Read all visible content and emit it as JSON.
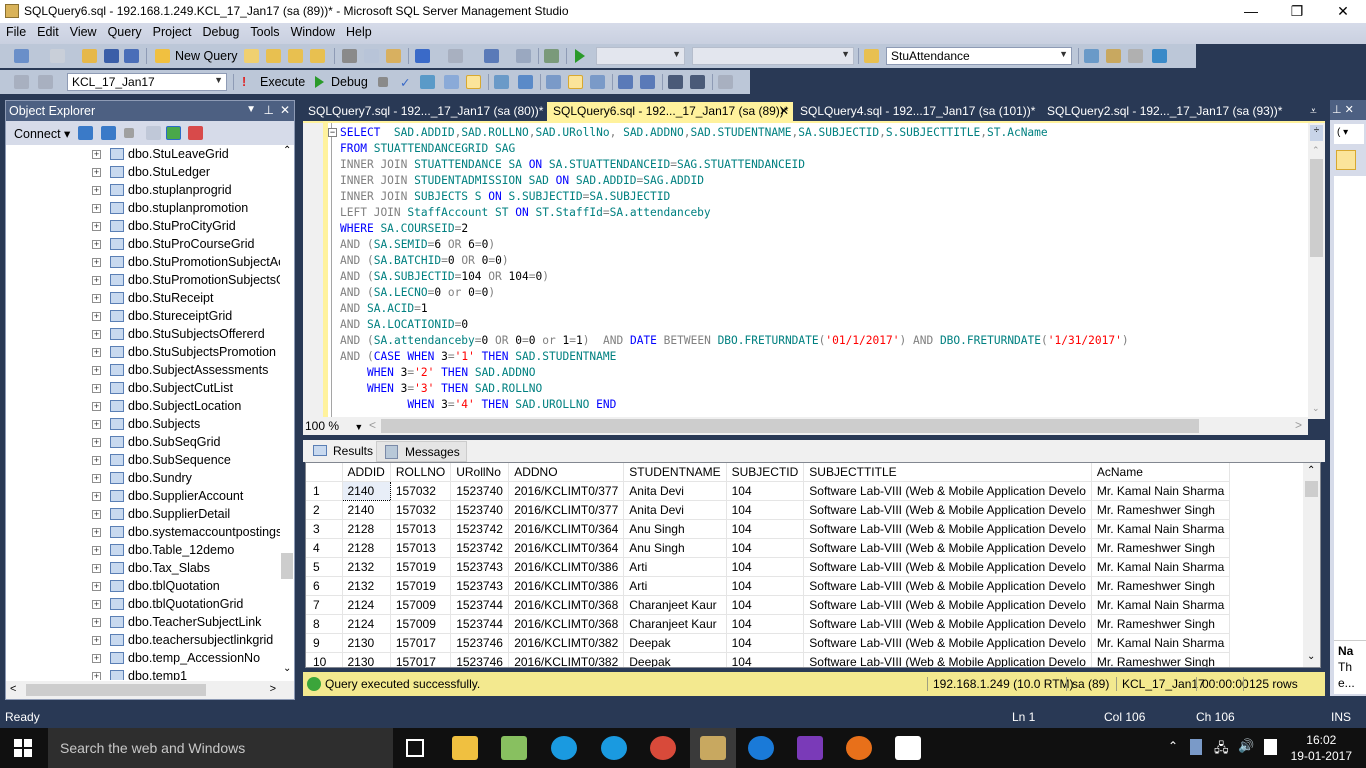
{
  "window": {
    "title": "SQLQuery6.sql - 192.168.1.249.KCL_17_Jan17 (sa (89))* - Microsoft SQL Server Management Studio",
    "minimize": "—",
    "restore": "❐",
    "close": "✕"
  },
  "menu": [
    "File",
    "Edit",
    "View",
    "Query",
    "Project",
    "Debug",
    "Tools",
    "Window",
    "Help"
  ],
  "toolbar": {
    "new_query": "New Query",
    "find_combo": "StuAttendance",
    "database": "KCL_17_Jan17",
    "execute": "Execute",
    "debug": "Debug"
  },
  "object_explorer": {
    "title": "Object Explorer",
    "connect": "Connect",
    "items": [
      "dbo.StuLeaveGrid",
      "dbo.StuLedger",
      "dbo.stuplanprogrid",
      "dbo.stuplanpromotion",
      "dbo.StuProCityGrid",
      "dbo.StuProCourseGrid",
      "dbo.StuPromotionSubjectAc",
      "dbo.StuPromotionSubjectsG",
      "dbo.StuReceipt",
      "dbo.StureceiptGrid",
      "dbo.StuSubjectsOffererd",
      "dbo.StuSubjectsPromotion",
      "dbo.SubjectAssessments",
      "dbo.SubjectCutList",
      "dbo.SubjectLocation",
      "dbo.Subjects",
      "dbo.SubSeqGrid",
      "dbo.SubSequence",
      "dbo.Sundry",
      "dbo.SupplierAccount",
      "dbo.SupplierDetail",
      "dbo.systemaccountpostings",
      "dbo.Table_12demo",
      "dbo.Tax_Slabs",
      "dbo.tblQuotation",
      "dbo.tblQuotationGrid",
      "dbo.TeacherSubjectLink",
      "dbo.teachersubjectlinkgrid",
      "dbo.temp_AccessionNo",
      "dbo.temp1"
    ]
  },
  "doc_tabs": [
    {
      "label": "SQLQuery7.sql - 192..._17_Jan17 (sa (80))*",
      "active": false
    },
    {
      "label": "SQLQuery6.sql - 192..._17_Jan17 (sa (89))*",
      "active": true
    },
    {
      "label": "SQLQuery4.sql - 192...17_Jan17 (sa (101))*",
      "active": false
    },
    {
      "label": "SQLQuery2.sql - 192..._17_Jan17 (sa (93))*",
      "active": false
    }
  ],
  "editor": {
    "zoom": "100 %",
    "lines": [
      "SELECT  SAD.ADDID,SAD.ROLLNO,SAD.URollNo, SAD.ADDNO,SAD.STUDENTNAME,SA.SUBJECTID,S.SUBJECTTITLE,ST.AcName",
      "FROM STUATTENDANCEGRID SAG",
      "INNER JOIN STUATTENDANCE SA ON SA.STUATTENDANCEID=SAG.STUATTENDANCEID",
      "INNER JOIN STUDENTADMISSION SAD ON SAD.ADDID=SAG.ADDID",
      "INNER JOIN SUBJECTS S ON S.SUBJECTID=SA.SUBJECTID",
      "LEFT JOIN StaffAccount ST ON ST.StaffId=SA.attendanceby",
      "WHERE SA.COURSEID=2",
      "AND (SA.SEMID=6 OR 6=0)",
      "AND (SA.BATCHID=0 OR 0=0)",
      "AND (SA.SUBJECTID=104 OR 104=0)",
      "AND (SA.LECNO=0 or 0=0)",
      "AND SA.ACID=1",
      "AND SA.LOCATIONID=0",
      "AND (SA.attendanceby=0 OR 0=0 or 1=1)  AND DATE BETWEEN DBO.FRETURNDATE('01/1/2017') AND DBO.FRETURNDATE('1/31/2017')",
      "AND (CASE WHEN 3='1' THEN SAD.STUDENTNAME",
      "    WHEN 3='2' THEN SAD.ADDNO",
      "    WHEN 3='3' THEN SAD.ROLLNO",
      "          WHEN 3='4' THEN SAD.UROLLNO END"
    ]
  },
  "results": {
    "tabs": [
      "Results",
      "Messages"
    ],
    "columns": [
      "",
      "ADDID",
      "ROLLNO",
      "URollNo",
      "ADDNO",
      "STUDENTNAME",
      "SUBJECTID",
      "SUBJECTTITLE",
      "AcName"
    ],
    "rows": [
      [
        "1",
        "2140",
        "157032",
        "1523740",
        "2016/KCLIMT0/377",
        "Anita Devi",
        "104",
        "Software Lab-VIII (Web & Mobile Application Develo",
        "Mr. Kamal Nain Sharma"
      ],
      [
        "2",
        "2140",
        "157032",
        "1523740",
        "2016/KCLIMT0/377",
        "Anita Devi",
        "104",
        "Software Lab-VIII (Web & Mobile Application Develo",
        "Mr. Rameshwer Singh"
      ],
      [
        "3",
        "2128",
        "157013",
        "1523742",
        "2016/KCLIMT0/364",
        "Anu Singh",
        "104",
        "Software Lab-VIII (Web & Mobile Application Develo",
        "Mr. Kamal Nain Sharma"
      ],
      [
        "4",
        "2128",
        "157013",
        "1523742",
        "2016/KCLIMT0/364",
        "Anu Singh",
        "104",
        "Software Lab-VIII (Web & Mobile Application Develo",
        "Mr. Rameshwer Singh"
      ],
      [
        "5",
        "2132",
        "157019",
        "1523743",
        "2016/KCLIMT0/386",
        "Arti",
        "104",
        "Software Lab-VIII (Web & Mobile Application Develo",
        "Mr. Kamal Nain Sharma"
      ],
      [
        "6",
        "2132",
        "157019",
        "1523743",
        "2016/KCLIMT0/386",
        "Arti",
        "104",
        "Software Lab-VIII (Web & Mobile Application Develo",
        "Mr. Rameshwer Singh"
      ],
      [
        "7",
        "2124",
        "157009",
        "1523744",
        "2016/KCLIMT0/368",
        "Charanjeet Kaur",
        "104",
        "Software Lab-VIII (Web & Mobile Application Develo",
        "Mr. Kamal Nain Sharma"
      ],
      [
        "8",
        "2124",
        "157009",
        "1523744",
        "2016/KCLIMT0/368",
        "Charanjeet Kaur",
        "104",
        "Software Lab-VIII (Web & Mobile Application Develo",
        "Mr. Rameshwer Singh"
      ],
      [
        "9",
        "2130",
        "157017",
        "1523746",
        "2016/KCLIMT0/382",
        "Deepak",
        "104",
        "Software Lab-VIII (Web & Mobile Application Develo",
        "Mr. Kamal Nain Sharma"
      ],
      [
        "10",
        "2130",
        "157017",
        "1523746",
        "2016/KCLIMT0/382",
        "Deepak",
        "104",
        "Software Lab-VIII (Web & Mobile Application Develo",
        "Mr. Rameshwer Singh"
      ]
    ]
  },
  "query_status": {
    "message": "Query executed successfully.",
    "server": "192.168.1.249 (10.0 RTM)",
    "user": "sa (89)",
    "database": "KCL_17_Jan17",
    "elapsed": "00:00:00",
    "rows": "125 rows"
  },
  "app_status": {
    "ready": "Ready",
    "ln": "Ln 1",
    "col": "Col 106",
    "ch": "Ch 106",
    "mode": "INS"
  },
  "properties_panel": {
    "name_label": "Na",
    "line2": "Th",
    "line3": "e..."
  },
  "taskbar": {
    "search_placeholder": "Search the web and Windows",
    "time": "16:02",
    "date": "19-01-2017"
  },
  "colors": {
    "chrome": "#293955",
    "active_tab": "#fff29d",
    "status_bar": "#f3e98f"
  }
}
